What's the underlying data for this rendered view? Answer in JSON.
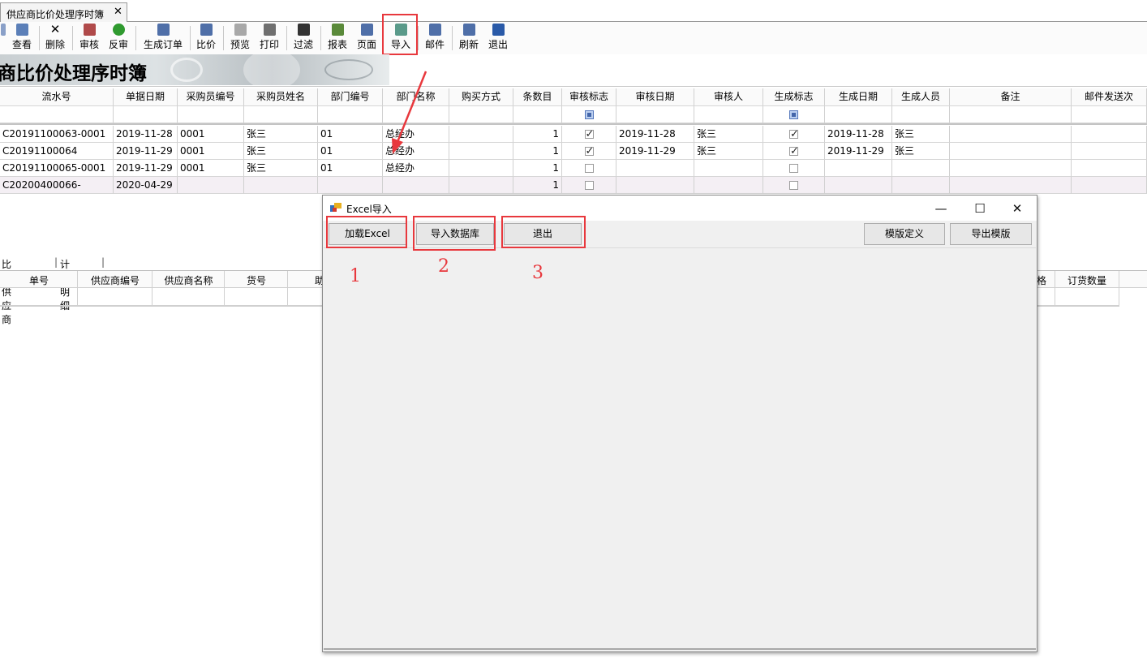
{
  "tab": {
    "title": "供应商比价处理序时簿",
    "close": "✕"
  },
  "toolbar": {
    "items": [
      {
        "label": "查看",
        "color": "#5b7fb8"
      },
      {
        "label": "删除",
        "color": "#222222"
      },
      {
        "label": "审核",
        "color": "#b04a4a"
      },
      {
        "label": "反审",
        "color": "#2f9a2f"
      },
      {
        "label": "生成订单",
        "color": "#4f6fa8"
      },
      {
        "label": "比价",
        "color": "#4f6fa8"
      },
      {
        "label": "预览",
        "color": "#8a8a8a"
      },
      {
        "label": "打印",
        "color": "#6f6f6f"
      },
      {
        "label": "过滤",
        "color": "#333333"
      },
      {
        "label": "报表",
        "color": "#5a8a3a"
      },
      {
        "label": "页面",
        "color": "#4f6fa8"
      },
      {
        "label": "导入",
        "color": "#5a9a8a"
      },
      {
        "label": "邮件",
        "color": "#4f6fa8"
      },
      {
        "label": "刷新",
        "color": "#4f6fa8"
      },
      {
        "label": "退出",
        "color": "#2a5aa8"
      }
    ]
  },
  "banner": {
    "title": "商比价处理序时簿"
  },
  "main_grid": {
    "columns": [
      "流水号",
      "单据日期",
      "采购员编号",
      "采购员姓名",
      "部门编号",
      "部门名称",
      "购买方式",
      "条数目",
      "审核标志",
      "审核日期",
      "审核人",
      "生成标志",
      "生成日期",
      "生成人员",
      "备注",
      "邮件发送次"
    ],
    "rows": [
      {
        "serial": "C20191100063-0001",
        "date": "2019-11-28",
        "buyer_no": "0001",
        "buyer_name": "张三",
        "dept_no": "01",
        "dept_name": "总经办",
        "method": "",
        "count": "1",
        "audit": true,
        "audit_date": "2019-11-28",
        "auditor": "张三",
        "gen": true,
        "gen_date": "2019-11-28",
        "gen_person": "张三",
        "remark": ""
      },
      {
        "serial": "C20191100064",
        "date": "2019-11-29",
        "buyer_no": "0001",
        "buyer_name": "张三",
        "dept_no": "01",
        "dept_name": "总经办",
        "method": "",
        "count": "1",
        "audit": true,
        "audit_date": "2019-11-29",
        "auditor": "张三",
        "gen": true,
        "gen_date": "2019-11-29",
        "gen_person": "张三",
        "remark": ""
      },
      {
        "serial": "C20191100065-0001",
        "date": "2019-11-29",
        "buyer_no": "0001",
        "buyer_name": "张三",
        "dept_no": "01",
        "dept_name": "总经办",
        "method": "",
        "count": "1",
        "audit": false,
        "audit_date": "",
        "auditor": "",
        "gen": false,
        "gen_date": "",
        "gen_person": "",
        "remark": ""
      },
      {
        "serial": "C20200400066-",
        "date": "2020-04-29",
        "buyer_no": "",
        "buyer_name": "",
        "dept_no": "",
        "dept_name": "",
        "method": "",
        "count": "1",
        "audit": false,
        "audit_date": "",
        "auditor": "",
        "gen": false,
        "gen_date": "",
        "gen_person": "",
        "remark": ""
      }
    ]
  },
  "lower_tabs": [
    "比价供应商",
    "计划明细"
  ],
  "lower_grid": {
    "columns_left": [
      "单号",
      "供应商编号",
      "供应商名称",
      "货号",
      "助"
    ],
    "columns_right": [
      "格",
      "订货数量"
    ]
  },
  "dialog": {
    "title": "Excel导入",
    "minimize": "—",
    "maximize": "☐",
    "close": "✕",
    "buttons": {
      "load_excel": "加载Excel",
      "import_db": "导入数据库",
      "exit": "退出",
      "template_define": "模版定义",
      "export_template": "导出模版"
    }
  },
  "annotations": {
    "one": "1",
    "two": "2",
    "three": "3"
  },
  "colors": {
    "highlight": "#e8383d"
  }
}
